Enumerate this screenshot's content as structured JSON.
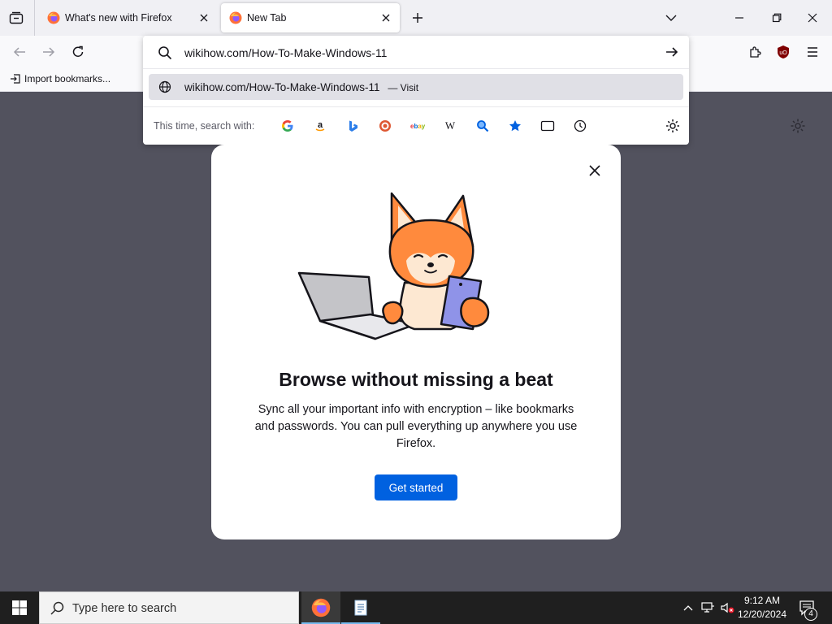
{
  "browser": {
    "tabs": [
      {
        "title": "What's new with Firefox",
        "favicon": "firefox-icon",
        "active": false
      },
      {
        "title": "New Tab",
        "favicon": "firefox-icon",
        "active": true
      }
    ],
    "icons": {
      "list_all_tabs": "list-all-tabs-icon",
      "new_tab": "plus-icon",
      "tab_overflow": "chevron-down-icon",
      "back": "back-arrow-icon",
      "forward": "forward-arrow-icon",
      "reload": "reload-icon",
      "extensions": "puzzle-icon",
      "ublock": "ublock-origin-icon",
      "menu": "hamburger-menu-icon"
    },
    "bookmarks_bar": {
      "import_label": "Import bookmarks..."
    }
  },
  "urlbar": {
    "value": "wikihow.com/How-To-Make-Windows-11",
    "result": {
      "url": "wikihow.com/How-To-Make-Windows-11",
      "action": "— Visit"
    },
    "one_off_label": "This time, search with:",
    "engines": [
      "Google",
      "Amazon",
      "Bing",
      "DuckDuckGo",
      "eBay",
      "Wikipedia",
      "Search",
      "Bookmarks",
      "Tabs",
      "History"
    ]
  },
  "modal": {
    "title": "Browse without missing a beat",
    "body": "Sync all your important info with encryption – like bookmarks and passwords. You can pull everything up anywhere you use Firefox.",
    "cta": "Get started"
  },
  "taskbar": {
    "search_placeholder": "Type here to search",
    "time": "9:12 AM",
    "date": "12/20/2024",
    "notification_count": "4"
  },
  "colors": {
    "accent": "#0061e0",
    "content_bg": "#52525e",
    "taskbar_bg": "#1f1f1f",
    "firefox_orange": "#ff7139"
  }
}
